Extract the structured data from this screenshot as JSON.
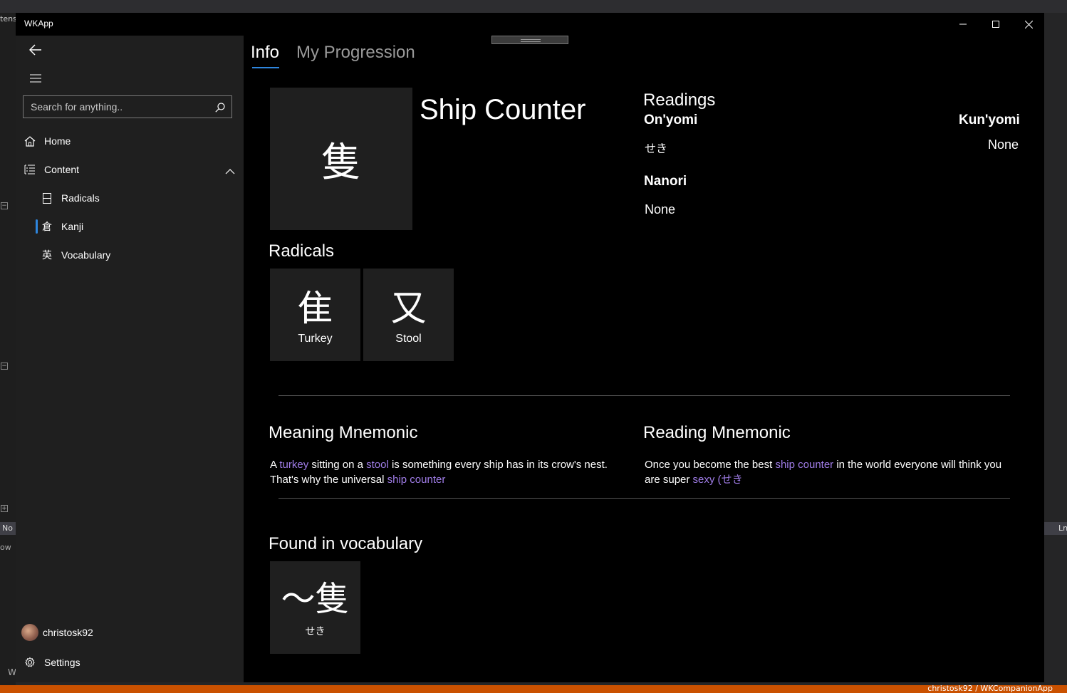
{
  "background": {
    "left_label": "tens",
    "left_status": "No",
    "left_output": "ow",
    "left_bottom": "W",
    "right_status": "Ln",
    "repo_text": "christosk92 / WKCompanionApp"
  },
  "window": {
    "title": "WKApp",
    "minimize_glyph": "—",
    "maximize_glyph": "☐",
    "close_glyph": "✕"
  },
  "nav": {
    "search_placeholder": "Search for anything..",
    "items": [
      {
        "label": "Home",
        "icon": "home-icon"
      },
      {
        "label": "Content",
        "icon": "list-icon",
        "expanded": true
      },
      {
        "label": "Radicals",
        "icon": "radicals-icon",
        "glyph": "⌸"
      },
      {
        "label": "Kanji",
        "icon": "kanji-icon",
        "glyph": "倉",
        "selected": true
      },
      {
        "label": "Vocabulary",
        "icon": "vocabulary-icon",
        "glyph": "英"
      }
    ],
    "user": {
      "name": "christosk92"
    },
    "settings_label": "Settings"
  },
  "tabs": [
    {
      "label": "Info",
      "active": true
    },
    {
      "label": "My Progression",
      "active": false
    }
  ],
  "kanji": {
    "character": "隻",
    "meaning": "Ship Counter"
  },
  "readings": {
    "title": "Readings",
    "onyomi_label": "On'yomi",
    "onyomi_value": "せき",
    "kunyomi_label": "Kun'yomi",
    "kunyomi_value": "None",
    "nanori_label": "Nanori",
    "nanori_value": "None"
  },
  "radicals": {
    "title": "Radicals",
    "items": [
      {
        "character": "隹",
        "name": "Turkey"
      },
      {
        "character": "又",
        "name": "Stool"
      }
    ]
  },
  "meaning_mnemonic": {
    "title": "Meaning Mnemonic",
    "parts": [
      "A ",
      "turkey",
      " sitting on a ",
      "stool",
      " is something every ship has in its crow's nest. That's why the universal ",
      "ship counter"
    ]
  },
  "reading_mnemonic": {
    "title": "Reading Mnemonic",
    "parts": [
      "Once you become the best ",
      "ship counter",
      " in the world everyone will think you are super ",
      "sexy",
      " (",
      "せき"
    ]
  },
  "vocabulary": {
    "title": "Found in vocabulary",
    "items": [
      {
        "characters": "〜隻",
        "reading": "せき"
      }
    ]
  },
  "colors": {
    "accent": "#2e86de",
    "highlight": "#a07de8",
    "tile": "#1f1f1f",
    "nav_bg": "#1f1f1f",
    "status_orange": "#ca5100"
  }
}
